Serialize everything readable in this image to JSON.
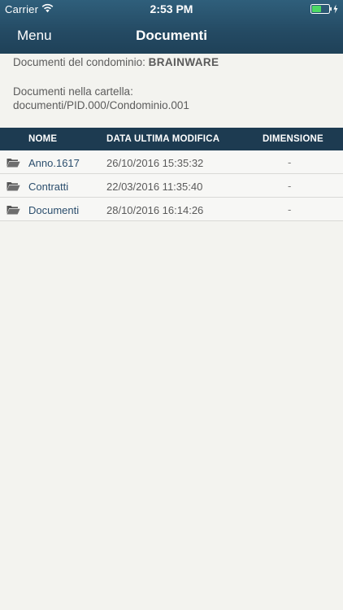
{
  "status_bar": {
    "carrier": "Carrier",
    "time": "2:53 PM",
    "battery_color": "#4cd964"
  },
  "nav": {
    "menu_label": "Menu",
    "title": "Documenti"
  },
  "info": {
    "condominio_label": "Documenti del condominio:",
    "condominio_name": "BRAINWARE",
    "folder_label": "Documenti nella cartella:",
    "folder_path": "documenti/PID.000/Condominio.001"
  },
  "table": {
    "headers": {
      "name": "NOME",
      "date": "DATA ULTIMA MODIFICA",
      "size": "DIMENSIONE"
    },
    "rows": [
      {
        "icon": "folder-open-icon",
        "name": "Anno.1617",
        "date": "26/10/2016 15:35:32",
        "size": "-"
      },
      {
        "icon": "folder-open-icon",
        "name": "Contratti",
        "date": "22/03/2016 11:35:40",
        "size": "-"
      },
      {
        "icon": "folder-open-icon",
        "name": "Documenti",
        "date": "28/10/2016 16:14:26",
        "size": "-"
      }
    ]
  },
  "colors": {
    "header_top": "#2f5f7b",
    "header_bottom": "#1f4158",
    "table_header": "#1d3b51",
    "link_text": "#2b4e6d",
    "background": "#f3f3ef"
  }
}
